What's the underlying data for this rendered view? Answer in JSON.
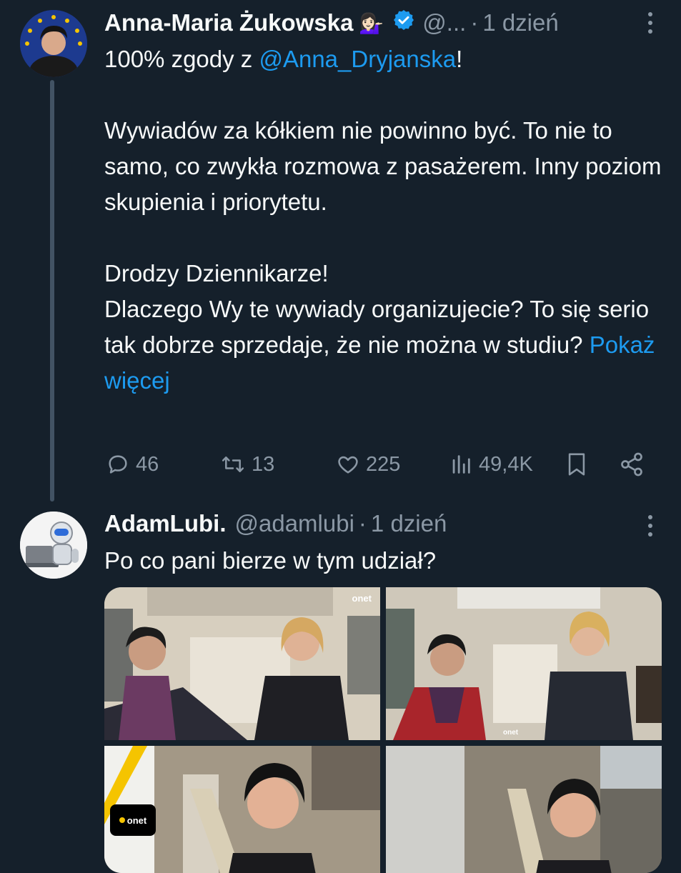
{
  "tweet1": {
    "name": "Anna-Maria Żukowska",
    "emoji": "💁🏻‍♀️",
    "handle": "@...",
    "time": "1 dzień",
    "lines": [
      {
        "before": "100% zgody z ",
        "mention": "@Anna_Dryjanska",
        "after": "!"
      },
      {
        "text": ""
      },
      {
        "text": "Wywiadów za kółkiem nie powinno być. To nie to samo, co zwykła rozmowa z pasażerem. Inny poziom skupienia i priorytetu."
      },
      {
        "text": ""
      },
      {
        "text": "Drodzy Dziennikarze!"
      },
      {
        "text": "Dlaczego Wy te wywiady organizujecie? To się serio tak dobrze sprzedaje, że nie można w studiu?",
        "more": "Pokaż więcej"
      }
    ],
    "stats": {
      "replies": "46",
      "retweets": "13",
      "likes": "225",
      "views": "49,4K"
    }
  },
  "tweet2": {
    "name": "AdamLubi.",
    "handle": "@adamlubi",
    "time": "1 dzień",
    "text": "Po co pani bierze w tym udział?",
    "media": {
      "logo_text": "onet"
    }
  },
  "colors": {
    "background": "#15202b",
    "text": "#f7f9f9",
    "muted": "#8b98a5",
    "link": "#1d9bf0",
    "verified": "#1d9bf0"
  }
}
